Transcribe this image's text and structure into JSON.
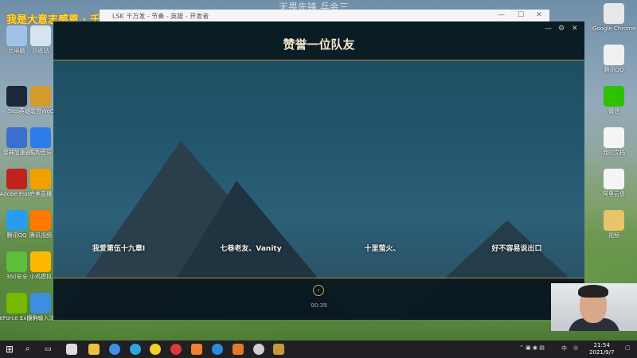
{
  "overlay": {
    "top_text": "无畏先锋 兵金三",
    "banner_text": "我是大意志感恩 · 千免费的英雄"
  },
  "desktop_icons": [
    {
      "label": "此电脑",
      "color": "#9fc3e8",
      "icon": "computer-icon"
    },
    {
      "label": "回收站",
      "color": "#d6e4ef",
      "icon": "recycle-bin-icon"
    },
    {
      "label": "Steam",
      "color": "#1b2838",
      "icon": "steam-icon"
    },
    {
      "label": "英雄联盟WeGame版",
      "color": "#d39b2a",
      "icon": "lol-icon"
    },
    {
      "label": "雷神加速器",
      "color": "#3a6fd0",
      "icon": "accelerator-icon"
    },
    {
      "label": "酷狗音乐",
      "color": "#2b7de9",
      "icon": "kugou-icon"
    },
    {
      "label": "Adobe Flash",
      "color": "#c0231e",
      "icon": "flash-icon"
    },
    {
      "label": "完美直播",
      "color": "#f2a000",
      "icon": "live-icon"
    },
    {
      "label": "腾讯QQ",
      "color": "#2a9cf0",
      "icon": "qq-folder-icon"
    },
    {
      "label": "腾讯视频",
      "color": "#ff7a00",
      "icon": "tencent-video-icon"
    },
    {
      "label": "360安全",
      "color": "#5fbe3c",
      "icon": "security-icon"
    },
    {
      "label": "小鸡模拟",
      "color": "#ffb800",
      "icon": "emulator-icon"
    },
    {
      "label": "GeForce Experience",
      "color": "#76b900",
      "icon": "nvidia-icon"
    },
    {
      "label": "搜狗输入法",
      "color": "#3b8ee0",
      "icon": "sogou-icon"
    }
  ],
  "right_icons": [
    {
      "label": "Google Chrome",
      "color": "#e8e8e8",
      "icon": "chrome-icon"
    },
    {
      "label": "腾讯QQ",
      "color": "#f0f0f0",
      "icon": "qq-icon"
    },
    {
      "label": "微信",
      "color": "#2dc100",
      "icon": "wechat-icon"
    },
    {
      "label": "我的文档",
      "color": "#f5f5f5",
      "icon": "document-icon"
    },
    {
      "label": "阿里云盘",
      "color": "#f5f5f5",
      "icon": "document-icon"
    },
    {
      "label": "视频",
      "color": "#e8c46a",
      "icon": "video-file-icon"
    }
  ],
  "browser": {
    "tab_text": "LSK 千万发 - 节奏 - 英雄 - 开发者"
  },
  "game": {
    "title": "赞誉一位队友",
    "players": [
      "我爱第伍十九章I",
      "七巷老友、Vanity",
      "十里萤火、",
      "好不容易说出口"
    ],
    "timer": "00:39"
  },
  "taskbar": {
    "time": "21:54",
    "date": "2021/9/7",
    "ime": "中"
  }
}
